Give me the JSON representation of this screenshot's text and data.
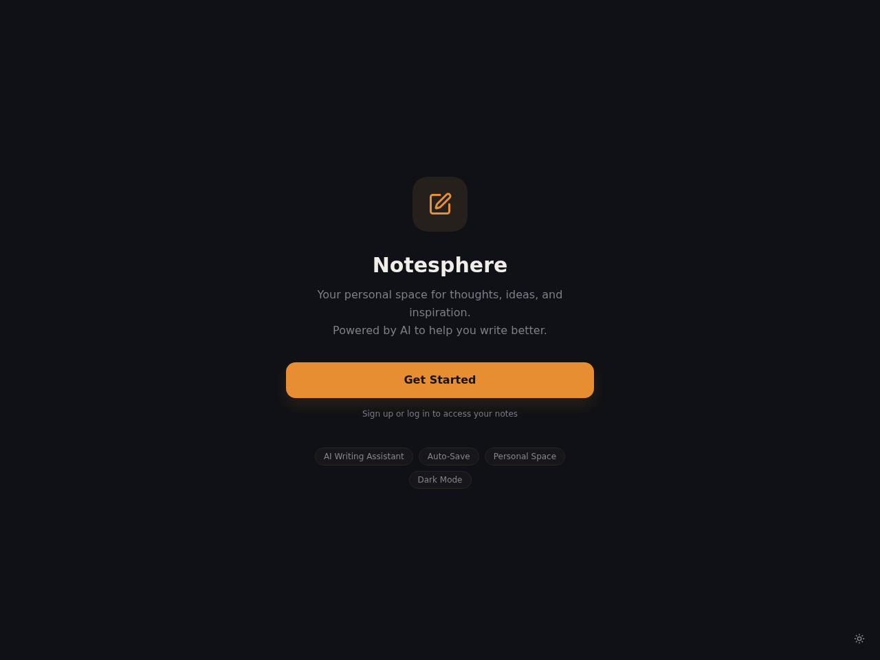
{
  "app": {
    "title": "Notesphere",
    "subtitle_lines": [
      "Your personal space for thoughts, ideas, and inspiration.",
      "Powered by AI to help you write better."
    ]
  },
  "cta_button": {
    "label": "Get Started"
  },
  "hint": "Sign up or log in to access your notes",
  "features": [
    "AI Writing Assistant",
    "Auto-Save",
    "Personal Space",
    "Dark Mode"
  ]
}
